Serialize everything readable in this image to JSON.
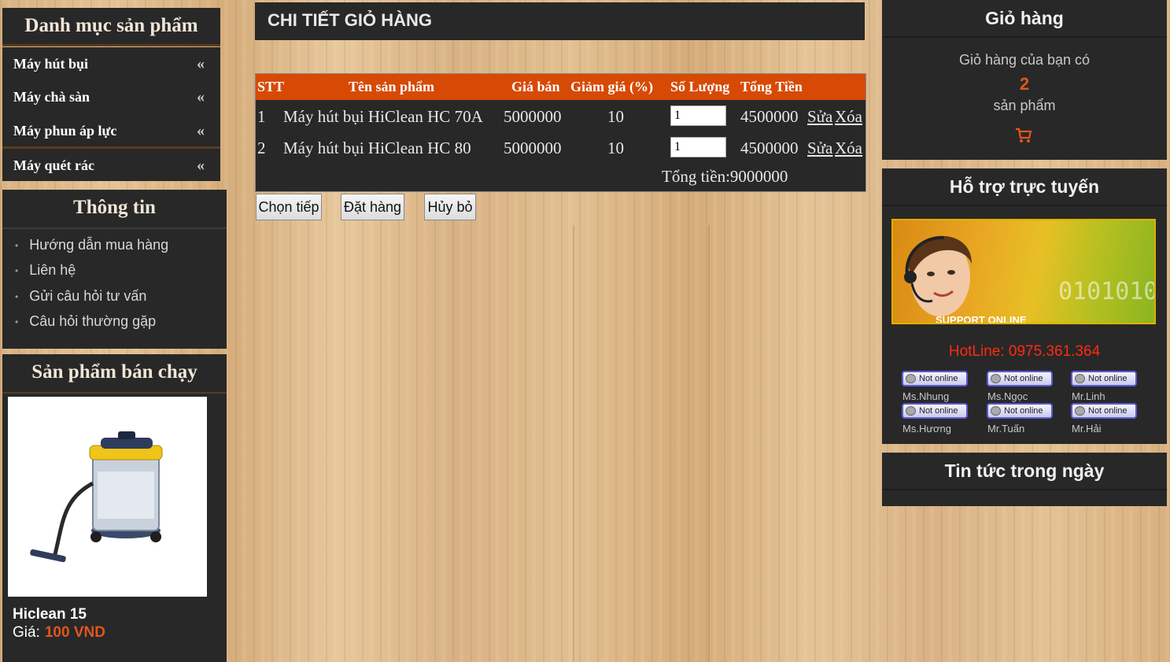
{
  "categories": {
    "title": "Danh mục sản phẩm",
    "items": [
      {
        "label": "Máy hút bụi",
        "chevron": "«"
      },
      {
        "label": "Máy chà sàn",
        "chevron": "«"
      },
      {
        "label": "Máy phun áp lực",
        "chevron": "«"
      },
      {
        "label": "Máy quét rác",
        "chevron": "«"
      }
    ]
  },
  "info": {
    "title": "Thông tin",
    "items": [
      {
        "label": "Hướng dẫn mua hàng"
      },
      {
        "label": "Liên hệ"
      },
      {
        "label": "Gửi câu hỏi tư vấn"
      },
      {
        "label": "Câu hỏi thường gặp"
      }
    ]
  },
  "bestseller": {
    "title": "Sản phẩm bán chạy",
    "product_name": "Hiclean 15",
    "price_label": "Giá:",
    "price_value": "100 VND"
  },
  "cart_detail": {
    "title": "CHI TIẾT GIỎ HÀNG",
    "headers": {
      "stt": "STT",
      "name": "Tên sản phẩm",
      "price": "Giá bán",
      "discount": "Giảm giá (%)",
      "qty": "Số Lượng",
      "total": "Tổng Tiền"
    },
    "rows": [
      {
        "stt": "1",
        "name": "Máy hút bụi HiClean HC 70A",
        "price": "5000000",
        "discount": "10",
        "qty": "1",
        "total": "4500000",
        "edit": "Sửa",
        "delete": "Xóa"
      },
      {
        "stt": "2",
        "name": "Máy hút bụi HiClean HC 80",
        "price": "5000000",
        "discount": "10",
        "qty": "1",
        "total": "4500000",
        "edit": "Sửa",
        "delete": "Xóa"
      }
    ],
    "grand_total": "Tổng tiền:9000000",
    "buttons": {
      "continue": "Chọn tiếp",
      "order": "Đặt hàng",
      "cancel": "Hủy bỏ"
    }
  },
  "cart_box": {
    "title": "Giỏ hàng",
    "line1": "Giỏ hàng của bạn có",
    "count": "2",
    "line3": "sản phẩm",
    "icon": "cart-icon"
  },
  "support": {
    "title": "Hỗ trợ trực tuyến",
    "banner_text": "SUPPORT ONLINE",
    "banner_digits": "0101010",
    "hotline": "HotLine: 0975.361.364",
    "status_text": "Not online",
    "agents": [
      "Ms.Nhung",
      "Ms.Ngọc",
      "Mr.Linh",
      "Ms.Hương",
      "Mr.Tuấn",
      "Mr.Hải"
    ]
  },
  "news": {
    "title": "Tin tức trong ngày"
  },
  "colors": {
    "accent": "#d64a05",
    "panel": "#282828",
    "price": "#e0561e",
    "hotline": "#ff2a10"
  }
}
